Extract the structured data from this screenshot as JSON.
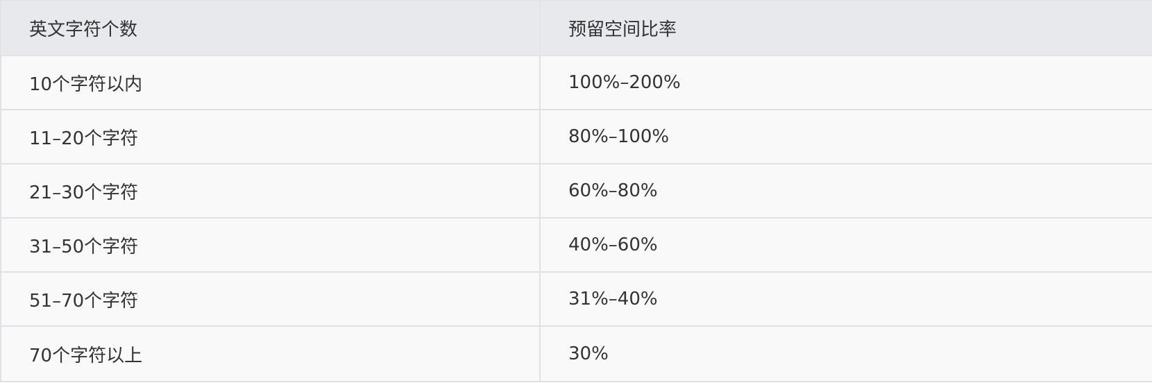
{
  "table": {
    "headers": [
      "英文字符个数",
      "预留空间比率"
    ],
    "rows": [
      [
        "10个字符以内",
        "100%–200%"
      ],
      [
        "11–20个字符",
        "80%–100%"
      ],
      [
        "21–30个字符",
        "60%–80%"
      ],
      [
        "31–50个字符",
        "40%–60%"
      ],
      [
        "51–70个字符",
        "31%–40%"
      ],
      [
        "70个字符以上",
        "30%"
      ]
    ]
  },
  "colors": {
    "header_bg": "#e8e9ec",
    "row_bg": "#f9f9f9",
    "border": "#dfe1e4",
    "text": "#333333"
  }
}
